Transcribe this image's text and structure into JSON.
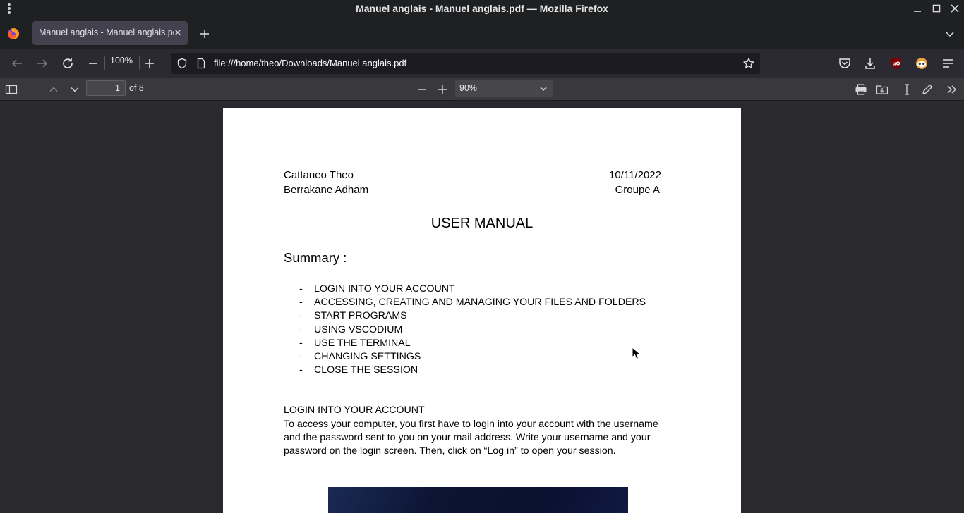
{
  "window": {
    "title": "Manuel anglais - Manuel anglais.pdf — Mozilla Firefox"
  },
  "tabs": [
    {
      "label": "Manuel anglais - Manuel anglais.pdf",
      "active": true
    }
  ],
  "navbar": {
    "zoom_level": "100%",
    "url": "file:///home/theo/Downloads/Manuel anglais.pdf"
  },
  "pdf_toolbar": {
    "page_number": "1",
    "page_count_label": "of 8",
    "scale": "90%"
  },
  "document": {
    "author1": "Cattaneo Theo",
    "author2": "Berrakane Adham",
    "date": "10/11/2022",
    "group": "Groupe A",
    "title": "USER MANUAL",
    "summary_heading": "Summary :",
    "summary_items": [
      "LOGIN INTO YOUR ACCOUNT",
      "ACCESSING, CREATING AND MANAGING YOUR FILES AND FOLDERS",
      "START PROGRAMS",
      "USING VSCODIUM",
      "USE THE TERMINAL",
      "CHANGING SETTINGS",
      "CLOSE THE SESSION"
    ],
    "bullet": "-",
    "section_heading": "LOGIN INTO YOUR ACCOUNT",
    "section_lines": [
      "To access your computer, you first have to login into your account with the username",
      "and the password sent to you on your mail address. Write your username and your",
      "password on the login screen. Then, click on “Log in” to open your session."
    ]
  },
  "colors": {
    "chrome_dark": "#1f2022",
    "toolbar": "#2b2a33",
    "pdf_toolbar": "#38383d",
    "viewer_bg": "#2a2a2e",
    "page": "#ffffff"
  }
}
